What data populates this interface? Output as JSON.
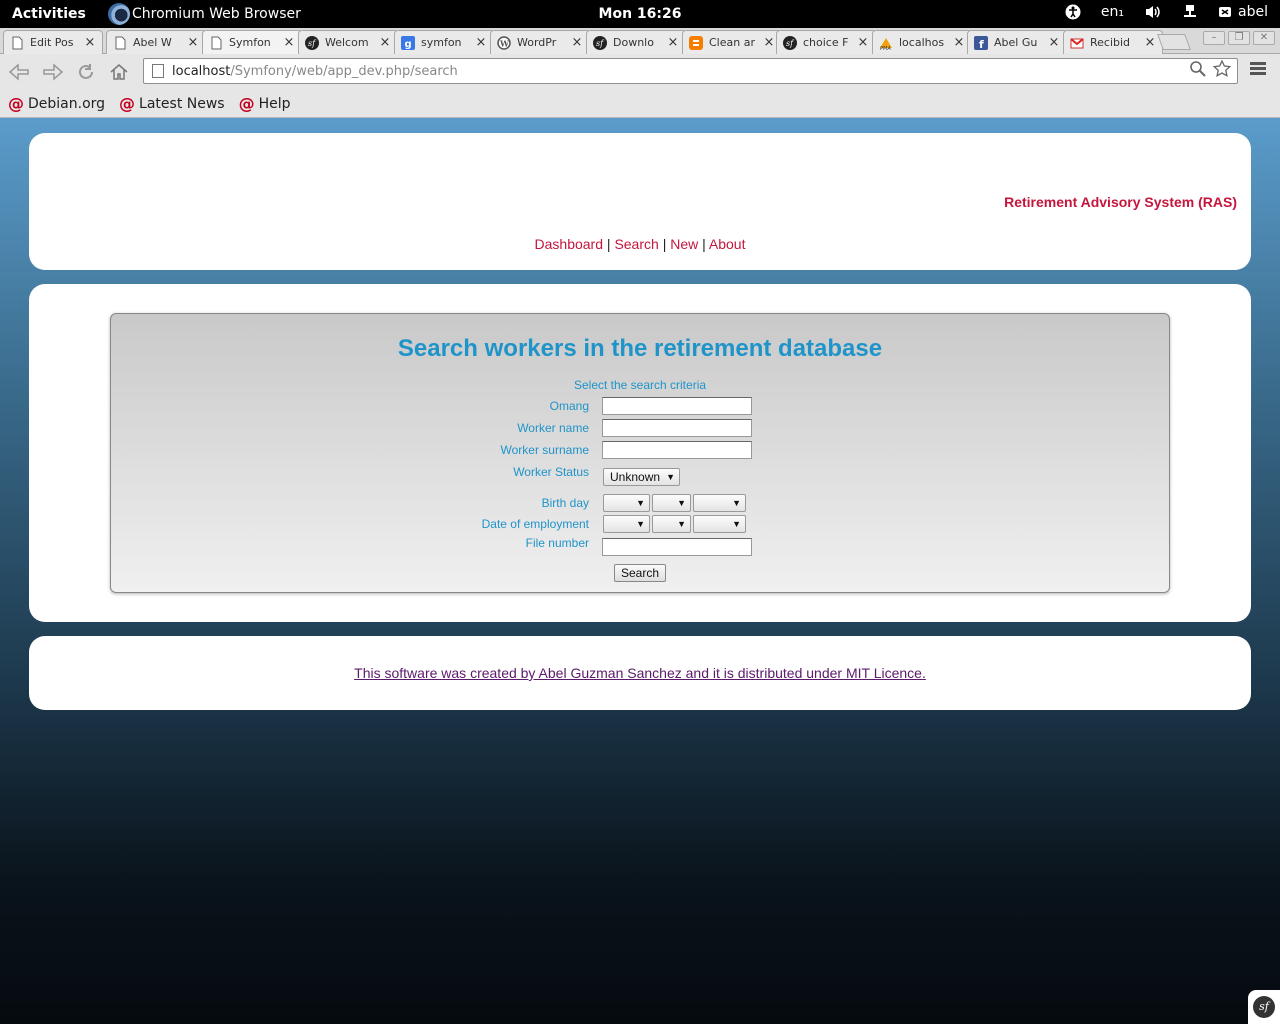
{
  "topbar": {
    "activities": "Activities",
    "app_name": "Chromium Web Browser",
    "clock": "Mon 16:26",
    "keyboard_layout": "en₁",
    "user": "abel"
  },
  "tabs": [
    {
      "title": "Edit Pos",
      "icon": "page-icon"
    },
    {
      "title": "Abel W",
      "icon": "page-icon"
    },
    {
      "title": "Symfon",
      "icon": "page-icon"
    },
    {
      "title": "Welcom",
      "icon": "symfony-icon"
    },
    {
      "title": "symfon",
      "icon": "google-icon"
    },
    {
      "title": "WordPr",
      "icon": "wordpress-icon"
    },
    {
      "title": "Downlo",
      "icon": "symfony-icon"
    },
    {
      "title": "Clean ar",
      "icon": "blogger-icon"
    },
    {
      "title": "choice F",
      "icon": "symfony-icon"
    },
    {
      "title": "localhos",
      "icon": "phpmyadmin-icon"
    },
    {
      "title": "Abel Gu",
      "icon": "facebook-icon"
    },
    {
      "title": "Recibid",
      "icon": "gmail-icon"
    }
  ],
  "address": {
    "host": "localhost",
    "path": "/Symfony/web/app_dev.php/search"
  },
  "bookmarks": [
    "Debian.org",
    "Latest News",
    "Help"
  ],
  "header": {
    "brand": "Retirement Advisory System (RAS)",
    "nav": [
      "Dashboard",
      "Search",
      "New",
      "About"
    ],
    "separator": "|"
  },
  "search": {
    "title": "Search workers in the retirement database",
    "subtitle": "Select the search criteria",
    "fields": {
      "omang": "Omang",
      "worker_name": "Worker name",
      "worker_surname": "Worker surname",
      "worker_status": "Worker Status",
      "birth_day": "Birth day",
      "date_of_employment": "Date of employment",
      "file_number": "File number"
    },
    "status_selected": "Unknown",
    "button": "Search"
  },
  "footer": {
    "text": "This software was created by Abel Guzman Sanchez and it is distributed under MIT Licence."
  },
  "colors": {
    "accent": "#1f94c9",
    "brand": "#c4163d",
    "footer_link": "#5b1a6a"
  }
}
